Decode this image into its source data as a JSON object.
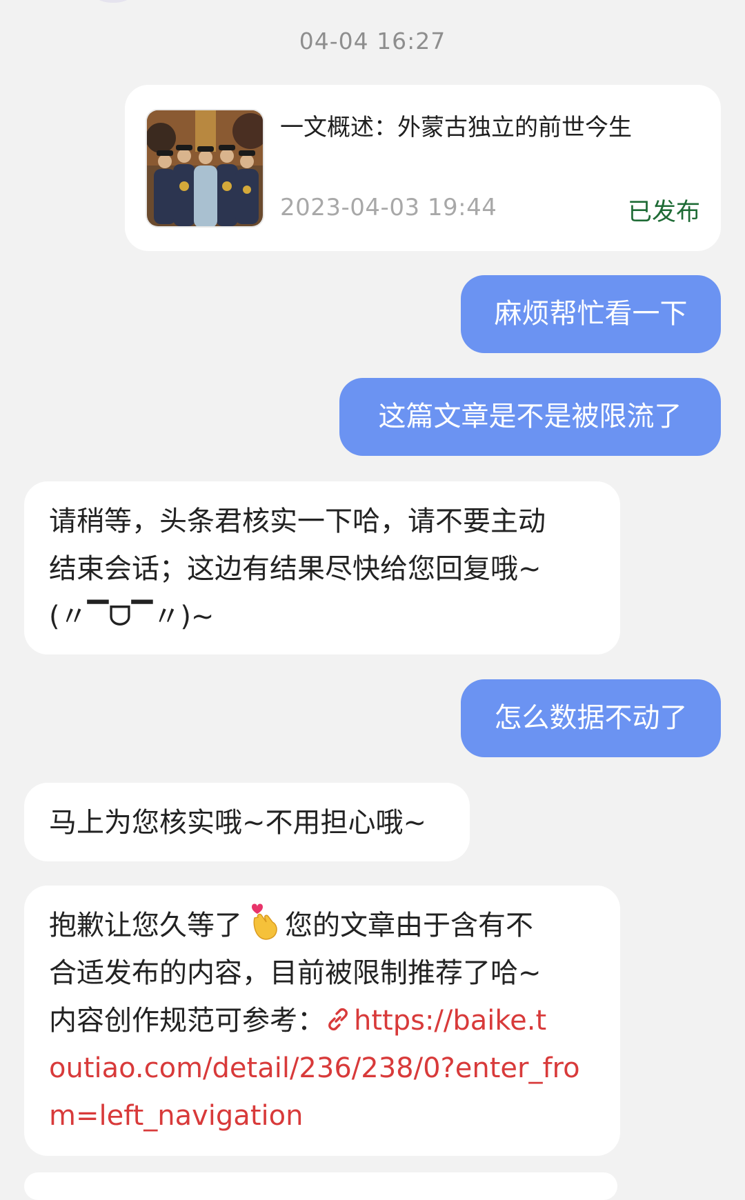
{
  "timestamp": "04-04 16:27",
  "article_card": {
    "title": "一文概述：外蒙古独立的前世今生",
    "date": "2023-04-03 19:44",
    "status": "已发布",
    "status_color": "#1e6b35",
    "thumbnail_icon": "article-thumbnail-image"
  },
  "messages": [
    {
      "side": "me",
      "text": "麻烦帮忙看一下"
    },
    {
      "side": "me",
      "text": "这篇文章是不是被限流了"
    },
    {
      "side": "them",
      "lines": [
        "请稍等，头条君核实一下哈，请不要主动",
        "结束会话；这边有结果尽快给您回复哦~",
        "(〃▔ᗜ▔〃)~"
      ]
    },
    {
      "side": "me",
      "text": "怎么数据不动了"
    },
    {
      "side": "them",
      "text": "马上为您核实哦~不用担心哦~"
    },
    {
      "side": "them",
      "line1_before": "抱歉让您久等了",
      "line1_after": "您的文章由于含有不",
      "line2": "合适发布的内容，目前被限制推荐了哈~",
      "line3_prefix": "内容创作规范可参考：",
      "link": "https://baike.toutiao.com/detail/236/238/0?enter_from=left_navigation",
      "link_line1": "https://baike.t",
      "link_line2": "outiao.com/detail/236/238/0?enter_fro",
      "link_line3": "m=left_navigation",
      "emoji_icon": "finger-heart-emoji-icon",
      "link_icon": "link-icon"
    }
  ],
  "colors": {
    "background": "#f2f2f2",
    "my_bubble": "#6b93f2",
    "their_bubble": "#ffffff",
    "link": "#d83a3a"
  }
}
